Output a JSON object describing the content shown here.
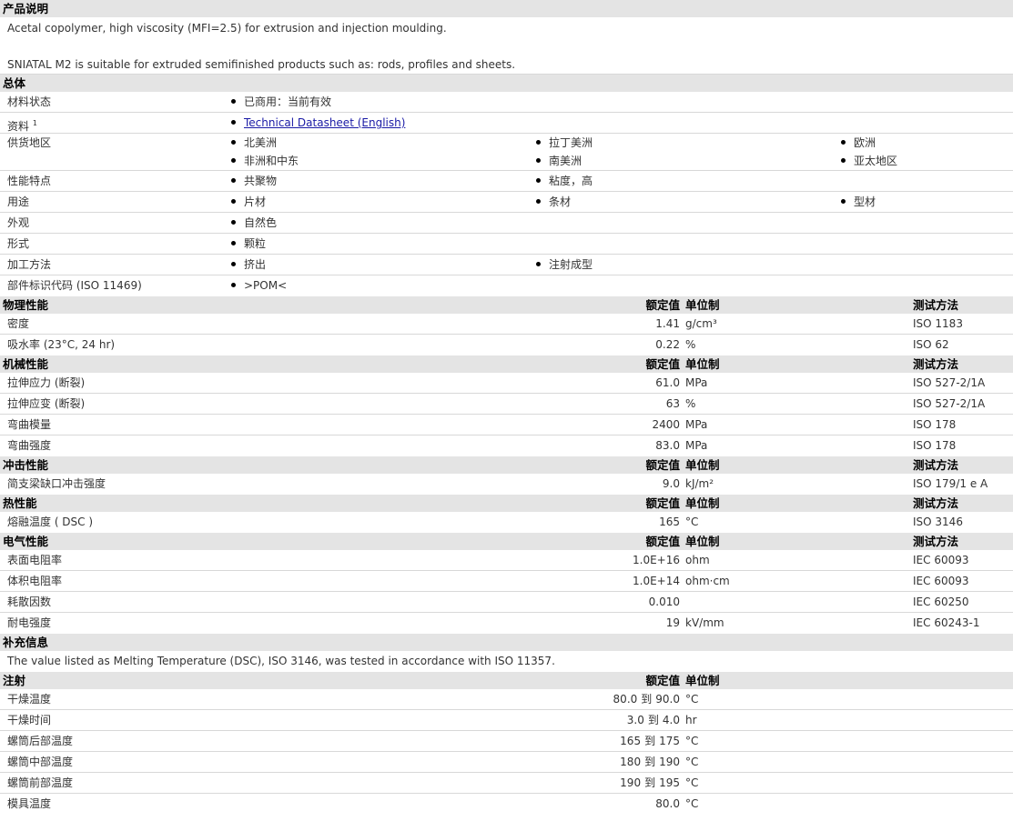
{
  "product": {
    "title": "产品说明",
    "line1": "Acetal copolymer, high viscosity (MFI=2.5) for extrusion and injection moulding.",
    "line2": "SNIATAL M2 is suitable for extruded semifinished products such as: rods, profiles and sheets."
  },
  "general": {
    "title": "总体",
    "status_label": "材料状态",
    "status_value": "已商用：当前有效",
    "doc_label": "资料",
    "doc_sup": "1",
    "doc_link": "Technical Datasheet (English)",
    "region_label": "供货地区",
    "regions": [
      "北美洲",
      "拉丁美洲",
      "欧洲",
      "非洲和中东",
      "南美洲",
      "亚太地区"
    ],
    "features_label": "性能特点",
    "features": [
      "共聚物",
      "粘度，高"
    ],
    "uses_label": "用途",
    "uses": [
      "片材",
      "条材",
      "型材"
    ],
    "appearance_label": "外观",
    "appearance": "自然色",
    "form_label": "形式",
    "form": "颗粒",
    "processing_label": "加工方法",
    "processing": [
      "挤出",
      "注射成型"
    ],
    "marking_label": "部件标识代码 (ISO 11469)",
    "marking": ">POM<"
  },
  "headers": {
    "value": "额定值",
    "unit": "单位制",
    "test": "测试方法"
  },
  "physical": {
    "title": "物理性能",
    "rows": [
      {
        "name": "密度",
        "value": "1.41",
        "unit": "g/cm³",
        "test": "ISO 1183"
      },
      {
        "name": "吸水率 (23°C, 24 hr)",
        "value": "0.22",
        "unit": "%",
        "test": "ISO 62"
      }
    ]
  },
  "mechanical": {
    "title": "机械性能",
    "rows": [
      {
        "name": "拉伸应力 (断裂)",
        "value": "61.0",
        "unit": "MPa",
        "test": "ISO 527-2/1A"
      },
      {
        "name": "拉伸应变 (断裂)",
        "value": "63",
        "unit": "%",
        "test": "ISO 527-2/1A"
      },
      {
        "name": "弯曲模量",
        "value": "2400",
        "unit": "MPa",
        "test": "ISO 178"
      },
      {
        "name": "弯曲强度",
        "value": "83.0",
        "unit": "MPa",
        "test": "ISO 178"
      }
    ]
  },
  "impact": {
    "title": "冲击性能",
    "rows": [
      {
        "name": "简支梁缺口冲击强度",
        "value": "9.0",
        "unit": "kJ/m²",
        "test": "ISO 179/1 e A"
      }
    ]
  },
  "thermal": {
    "title": "热性能",
    "rows": [
      {
        "name": "熔融温度 ( DSC )",
        "value": "165",
        "unit": "°C",
        "test": "ISO 3146"
      }
    ]
  },
  "electrical": {
    "title": "电气性能",
    "rows": [
      {
        "name": "表面电阻率",
        "value": "1.0E+16",
        "unit": "ohm",
        "test": "IEC 60093"
      },
      {
        "name": "体积电阻率",
        "value": "1.0E+14",
        "unit": "ohm·cm",
        "test": "IEC 60093"
      },
      {
        "name": "耗散因数",
        "value": "0.010",
        "unit": "",
        "test": "IEC 60250"
      },
      {
        "name": "耐电强度",
        "value": "19",
        "unit": "kV/mm",
        "test": "IEC 60243-1"
      }
    ]
  },
  "supplement": {
    "title": "补充信息",
    "text": "The value listed as Melting Temperature (DSC), ISO 3146, was tested in accordance with ISO 11357."
  },
  "injection": {
    "title": "注射",
    "to": "到",
    "rows": [
      {
        "name": "干燥温度",
        "low": "80.0",
        "high": "90.0",
        "unit": "°C"
      },
      {
        "name": "干燥时间",
        "low": "3.0",
        "high": "4.0",
        "unit": "hr"
      },
      {
        "name": "螺筒后部温度",
        "low": "165",
        "high": "175",
        "unit": "°C"
      },
      {
        "name": "螺筒中部温度",
        "low": "180",
        "high": "190",
        "unit": "°C"
      },
      {
        "name": "螺筒前部温度",
        "low": "190",
        "high": "195",
        "unit": "°C"
      },
      {
        "name": "模具温度",
        "low": "80.0",
        "high": "",
        "unit": "°C"
      }
    ]
  }
}
